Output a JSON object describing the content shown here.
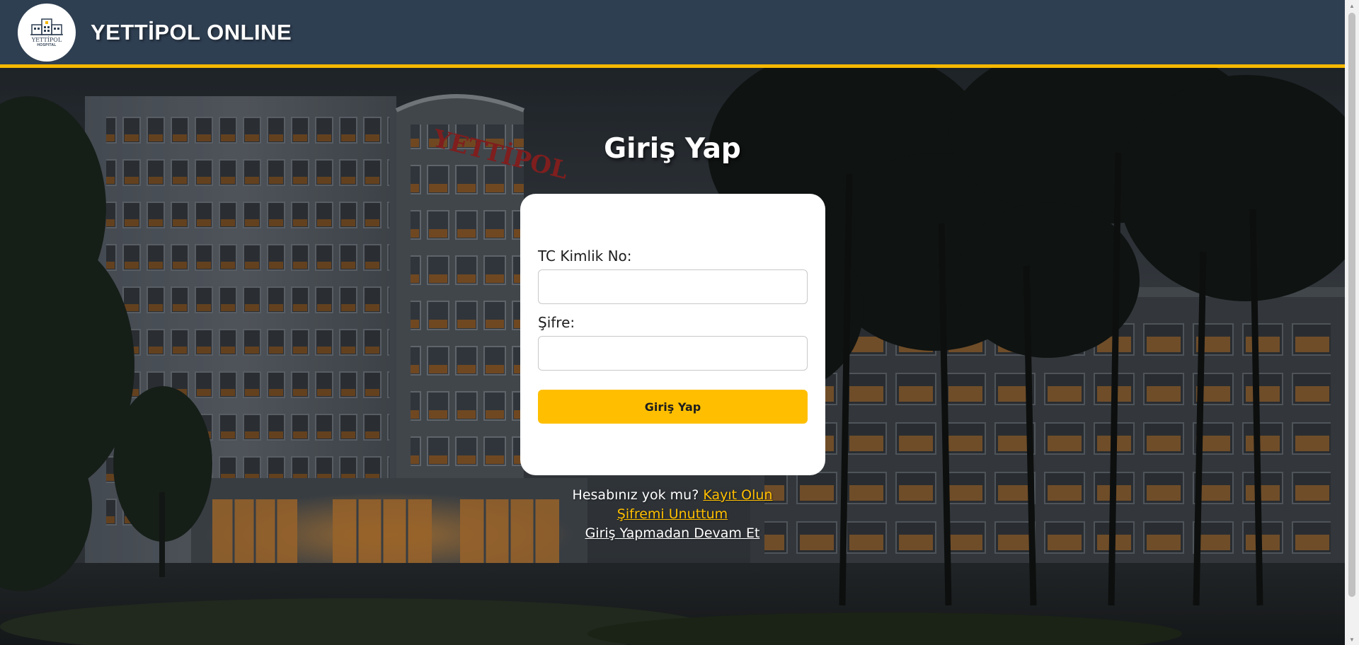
{
  "header": {
    "brand": "YETTİPOL ONLINE",
    "logo_name": "YETTİPOL",
    "logo_sub": "HOSPITAL"
  },
  "background": {
    "building_sign": "YETTİPOL"
  },
  "login": {
    "title": "Giriş Yap",
    "tc_label": "TC Kimlik No:",
    "tc_value": "",
    "password_label": "Şifre:",
    "password_value": "",
    "submit_label": "Giriş Yap"
  },
  "links": {
    "no_account_text": "Hesabınız yok mu?",
    "register_label": "Kayıt Olun",
    "forgot_label": "Şifremi Unuttum",
    "guest_label": "Giriş Yapmadan Devam Et"
  },
  "colors": {
    "header_bg": "#2f3f52",
    "accent": "#ffbf00",
    "card_bg": "#ffffff"
  }
}
